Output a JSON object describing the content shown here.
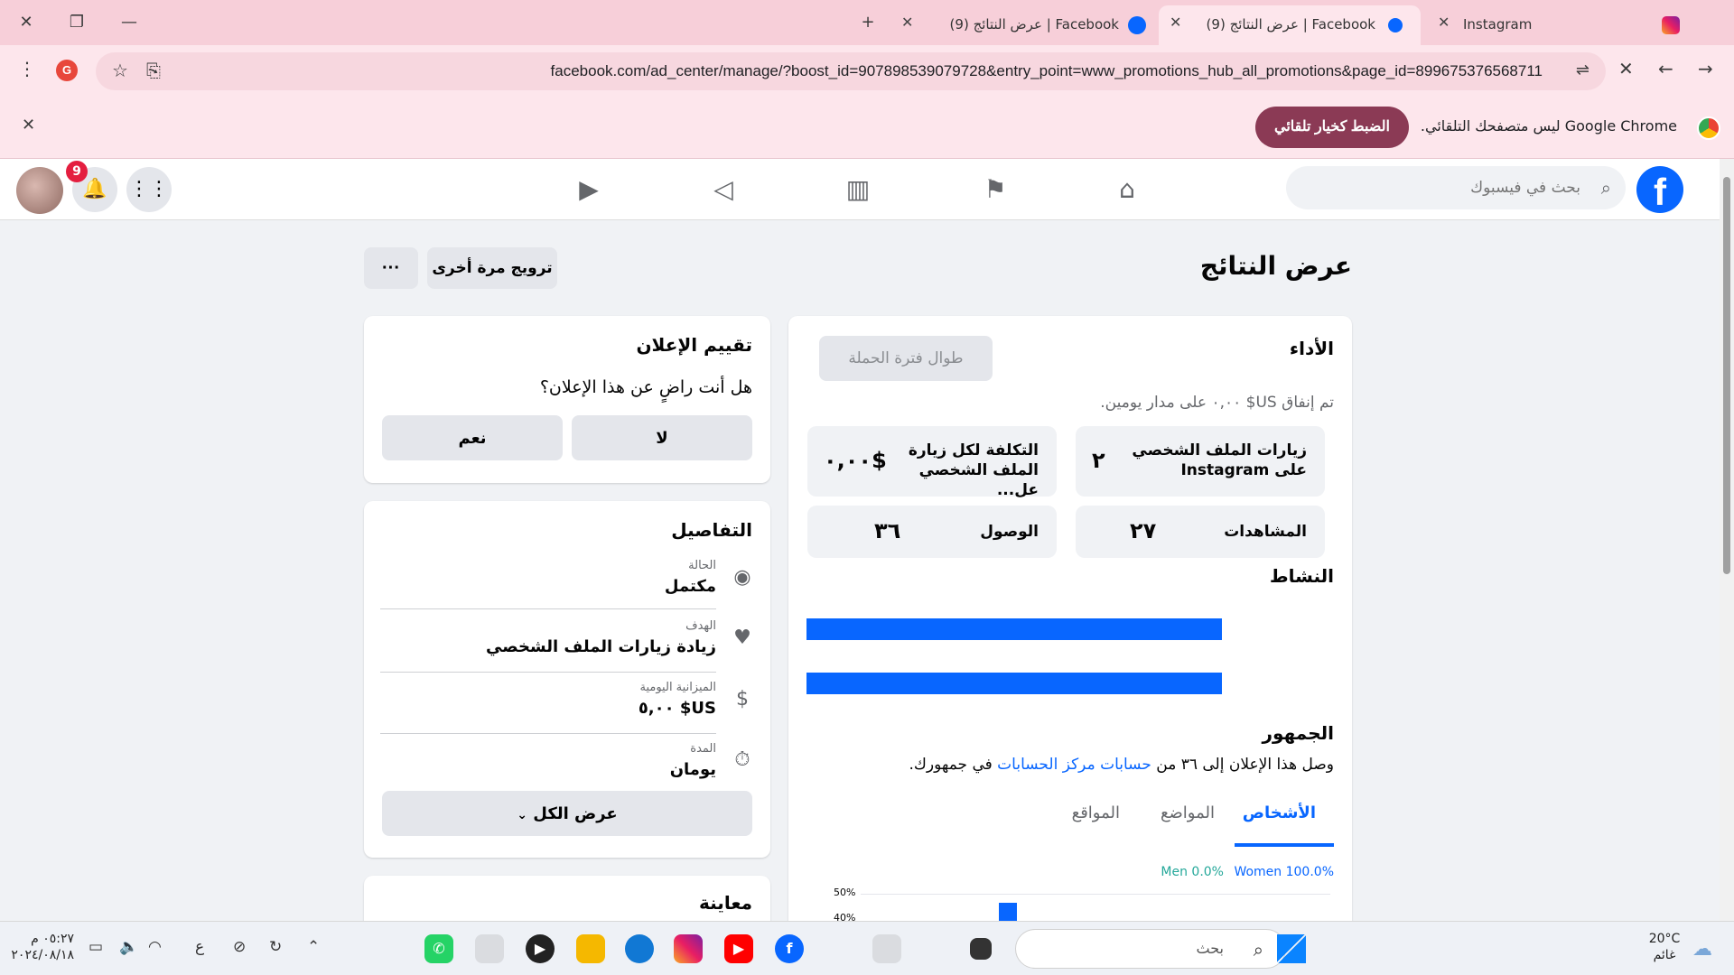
{
  "browser": {
    "tabs": [
      {
        "title": "Instagram",
        "active": false
      },
      {
        "title": "(9) عرض النتائج | Facebook",
        "active": true
      },
      {
        "title": "(9) عرض النتائج | Facebook",
        "active": false
      }
    ],
    "new_tab": "+",
    "url": "facebook.com/ad_center/manage/?boost_id=907898539079728&entry_point=www_promotions_hub_all_promotions&page_id=899675376568711",
    "profile_initial": "G",
    "infobar": {
      "message": "Google Chrome ليس متصفحك التلقائي.",
      "button": "الضبط كخيار تلقائي"
    }
  },
  "facebook": {
    "logo": "f",
    "search_placeholder": "بحث في فيسبوك",
    "notification_count": "9"
  },
  "page": {
    "title": "عرض النتائج",
    "boost_again": "ترويج مرة أخرى",
    "more": "···"
  },
  "performance": {
    "heading": "الأداء",
    "period_button": "طوال فترة الحملة",
    "spend_text": "تم إنفاق US$ ٠,٠٠ على مدار يومين.",
    "metrics": [
      {
        "label": "زيارات الملف الشخصي على Instagram",
        "value": "٢"
      },
      {
        "label": "التكلفة لكل زيارة الملف الشخصي عل...",
        "value": "$٠,٠٠"
      },
      {
        "label": "المشاهدات",
        "value": "٢٧"
      },
      {
        "label": "الوصول",
        "value": "٣٦"
      }
    ],
    "activity_heading": "النشاط",
    "activity_bars": [
      1.0,
      1.0
    ],
    "audience_heading": "الجمهور",
    "audience_text_before": "وصل هذا الإعلان إلى ٣٦ من",
    "audience_link": "حسابات مركز الحسابات",
    "audience_text_after": "في جمهورك.",
    "tabs": [
      "الأشخاص",
      "المواضع",
      "المواقع"
    ],
    "women_label": "Women 100.0%",
    "men_label": "Men 0.0%",
    "y_ticks": [
      "50%",
      "40%"
    ]
  },
  "rating": {
    "heading": "تقييم الإعلان",
    "question": "هل أنت راضٍ عن هذا الإعلان؟",
    "yes": "نعم",
    "no": "لا"
  },
  "details": {
    "heading": "التفاصيل",
    "rows": [
      {
        "label": "الحالة",
        "value": "مكتمل",
        "icon": "radio-icon"
      },
      {
        "label": "الهدف",
        "value": "زيادة زيارات الملف الشخصي",
        "icon": "heart-icon"
      },
      {
        "label": "الميزانية اليومية",
        "value": "US$ ٥,٠٠",
        "icon": "dollar-icon"
      },
      {
        "label": "المدة",
        "value": "يومان",
        "icon": "stopwatch-icon"
      }
    ],
    "view_all": "عرض الكل"
  },
  "preview": {
    "heading": "معاينة"
  },
  "taskbar": {
    "search": "بحث",
    "time": "٠٥:٢٧ م",
    "date": "٢٠٢٤/٠٨/١٨",
    "lang": "ع",
    "temperature": "20°C",
    "weather": "غائم"
  },
  "colors": {
    "fb_blue": "#0866ff",
    "women": "#0866ff",
    "men": "#25a89a",
    "infobar_button": "#8b3a55"
  }
}
